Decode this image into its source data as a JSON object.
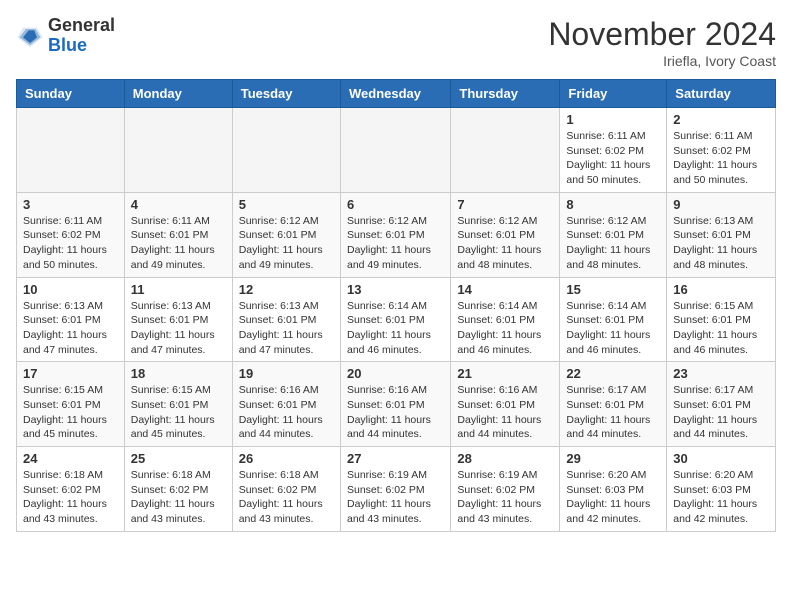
{
  "header": {
    "logo_general": "General",
    "logo_blue": "Blue",
    "month_title": "November 2024",
    "location": "Iriefla, Ivory Coast"
  },
  "days_of_week": [
    "Sunday",
    "Monday",
    "Tuesday",
    "Wednesday",
    "Thursday",
    "Friday",
    "Saturday"
  ],
  "weeks": [
    [
      {
        "day": "",
        "empty": true
      },
      {
        "day": "",
        "empty": true
      },
      {
        "day": "",
        "empty": true
      },
      {
        "day": "",
        "empty": true
      },
      {
        "day": "",
        "empty": true
      },
      {
        "day": "1",
        "sunrise": "Sunrise: 6:11 AM",
        "sunset": "Sunset: 6:02 PM",
        "daylight": "Daylight: 11 hours and 50 minutes."
      },
      {
        "day": "2",
        "sunrise": "Sunrise: 6:11 AM",
        "sunset": "Sunset: 6:02 PM",
        "daylight": "Daylight: 11 hours and 50 minutes."
      }
    ],
    [
      {
        "day": "3",
        "sunrise": "Sunrise: 6:11 AM",
        "sunset": "Sunset: 6:02 PM",
        "daylight": "Daylight: 11 hours and 50 minutes."
      },
      {
        "day": "4",
        "sunrise": "Sunrise: 6:11 AM",
        "sunset": "Sunset: 6:01 PM",
        "daylight": "Daylight: 11 hours and 49 minutes."
      },
      {
        "day": "5",
        "sunrise": "Sunrise: 6:12 AM",
        "sunset": "Sunset: 6:01 PM",
        "daylight": "Daylight: 11 hours and 49 minutes."
      },
      {
        "day": "6",
        "sunrise": "Sunrise: 6:12 AM",
        "sunset": "Sunset: 6:01 PM",
        "daylight": "Daylight: 11 hours and 49 minutes."
      },
      {
        "day": "7",
        "sunrise": "Sunrise: 6:12 AM",
        "sunset": "Sunset: 6:01 PM",
        "daylight": "Daylight: 11 hours and 48 minutes."
      },
      {
        "day": "8",
        "sunrise": "Sunrise: 6:12 AM",
        "sunset": "Sunset: 6:01 PM",
        "daylight": "Daylight: 11 hours and 48 minutes."
      },
      {
        "day": "9",
        "sunrise": "Sunrise: 6:13 AM",
        "sunset": "Sunset: 6:01 PM",
        "daylight": "Daylight: 11 hours and 48 minutes."
      }
    ],
    [
      {
        "day": "10",
        "sunrise": "Sunrise: 6:13 AM",
        "sunset": "Sunset: 6:01 PM",
        "daylight": "Daylight: 11 hours and 47 minutes."
      },
      {
        "day": "11",
        "sunrise": "Sunrise: 6:13 AM",
        "sunset": "Sunset: 6:01 PM",
        "daylight": "Daylight: 11 hours and 47 minutes."
      },
      {
        "day": "12",
        "sunrise": "Sunrise: 6:13 AM",
        "sunset": "Sunset: 6:01 PM",
        "daylight": "Daylight: 11 hours and 47 minutes."
      },
      {
        "day": "13",
        "sunrise": "Sunrise: 6:14 AM",
        "sunset": "Sunset: 6:01 PM",
        "daylight": "Daylight: 11 hours and 46 minutes."
      },
      {
        "day": "14",
        "sunrise": "Sunrise: 6:14 AM",
        "sunset": "Sunset: 6:01 PM",
        "daylight": "Daylight: 11 hours and 46 minutes."
      },
      {
        "day": "15",
        "sunrise": "Sunrise: 6:14 AM",
        "sunset": "Sunset: 6:01 PM",
        "daylight": "Daylight: 11 hours and 46 minutes."
      },
      {
        "day": "16",
        "sunrise": "Sunrise: 6:15 AM",
        "sunset": "Sunset: 6:01 PM",
        "daylight": "Daylight: 11 hours and 46 minutes."
      }
    ],
    [
      {
        "day": "17",
        "sunrise": "Sunrise: 6:15 AM",
        "sunset": "Sunset: 6:01 PM",
        "daylight": "Daylight: 11 hours and 45 minutes."
      },
      {
        "day": "18",
        "sunrise": "Sunrise: 6:15 AM",
        "sunset": "Sunset: 6:01 PM",
        "daylight": "Daylight: 11 hours and 45 minutes."
      },
      {
        "day": "19",
        "sunrise": "Sunrise: 6:16 AM",
        "sunset": "Sunset: 6:01 PM",
        "daylight": "Daylight: 11 hours and 44 minutes."
      },
      {
        "day": "20",
        "sunrise": "Sunrise: 6:16 AM",
        "sunset": "Sunset: 6:01 PM",
        "daylight": "Daylight: 11 hours and 44 minutes."
      },
      {
        "day": "21",
        "sunrise": "Sunrise: 6:16 AM",
        "sunset": "Sunset: 6:01 PM",
        "daylight": "Daylight: 11 hours and 44 minutes."
      },
      {
        "day": "22",
        "sunrise": "Sunrise: 6:17 AM",
        "sunset": "Sunset: 6:01 PM",
        "daylight": "Daylight: 11 hours and 44 minutes."
      },
      {
        "day": "23",
        "sunrise": "Sunrise: 6:17 AM",
        "sunset": "Sunset: 6:01 PM",
        "daylight": "Daylight: 11 hours and 44 minutes."
      }
    ],
    [
      {
        "day": "24",
        "sunrise": "Sunrise: 6:18 AM",
        "sunset": "Sunset: 6:02 PM",
        "daylight": "Daylight: 11 hours and 43 minutes."
      },
      {
        "day": "25",
        "sunrise": "Sunrise: 6:18 AM",
        "sunset": "Sunset: 6:02 PM",
        "daylight": "Daylight: 11 hours and 43 minutes."
      },
      {
        "day": "26",
        "sunrise": "Sunrise: 6:18 AM",
        "sunset": "Sunset: 6:02 PM",
        "daylight": "Daylight: 11 hours and 43 minutes."
      },
      {
        "day": "27",
        "sunrise": "Sunrise: 6:19 AM",
        "sunset": "Sunset: 6:02 PM",
        "daylight": "Daylight: 11 hours and 43 minutes."
      },
      {
        "day": "28",
        "sunrise": "Sunrise: 6:19 AM",
        "sunset": "Sunset: 6:02 PM",
        "daylight": "Daylight: 11 hours and 43 minutes."
      },
      {
        "day": "29",
        "sunrise": "Sunrise: 6:20 AM",
        "sunset": "Sunset: 6:03 PM",
        "daylight": "Daylight: 11 hours and 42 minutes."
      },
      {
        "day": "30",
        "sunrise": "Sunrise: 6:20 AM",
        "sunset": "Sunset: 6:03 PM",
        "daylight": "Daylight: 11 hours and 42 minutes."
      }
    ]
  ]
}
